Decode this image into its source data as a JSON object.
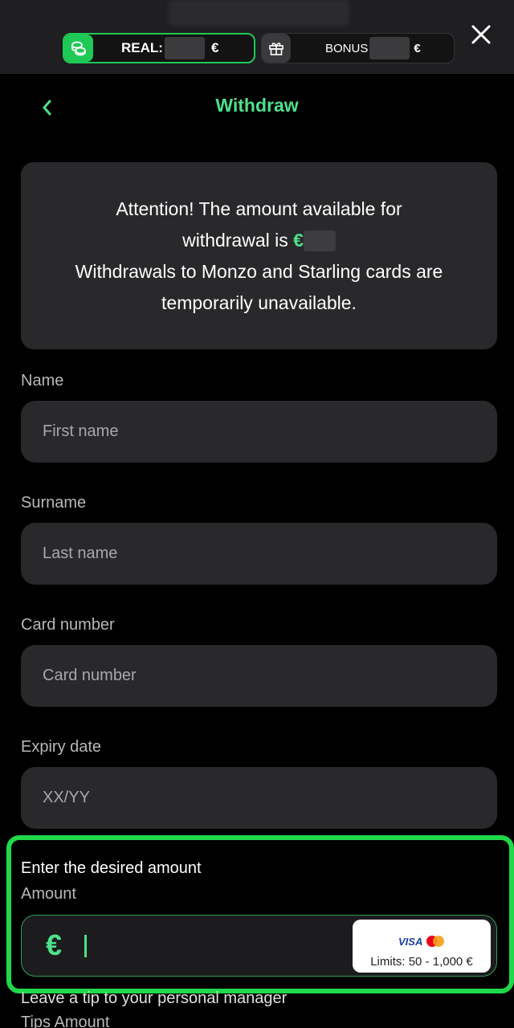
{
  "topbar": {
    "real_label": "REAL:",
    "real_currency": "€",
    "bonus_label": "BONUS",
    "bonus_currency": "€",
    "real_icon": "coins-icon",
    "bonus_icon": "gift-icon",
    "close_icon": "close-icon"
  },
  "header": {
    "title": "Withdraw",
    "back_icon": "chevron-left-icon"
  },
  "notice": {
    "line1": "Attention! The amount available for",
    "line2_prefix": "withdrawal is",
    "line2_currency": "€",
    "line3": "Withdrawals to Monzo and Starling cards are",
    "line4": "temporarily unavailable."
  },
  "form": {
    "name_label": "Name",
    "name_placeholder": "First name",
    "surname_label": "Surname",
    "surname_placeholder": "Last name",
    "card_label": "Card number",
    "card_placeholder": "Card number",
    "expiry_label": "Expiry date",
    "expiry_placeholder": "XX/YY"
  },
  "amount": {
    "title": "Enter the desired amount",
    "label": "Amount",
    "currency": "€",
    "value": "",
    "visa": "VISA",
    "limits": "Limits: 50 - 1,000 €"
  },
  "tips": {
    "title": "Leave a tip to your personal manager",
    "label": "Tips Amount"
  },
  "colors": {
    "accent": "#4ee08a",
    "highlight": "#1fd94a",
    "panel": "#29292b",
    "background": "#000000"
  }
}
